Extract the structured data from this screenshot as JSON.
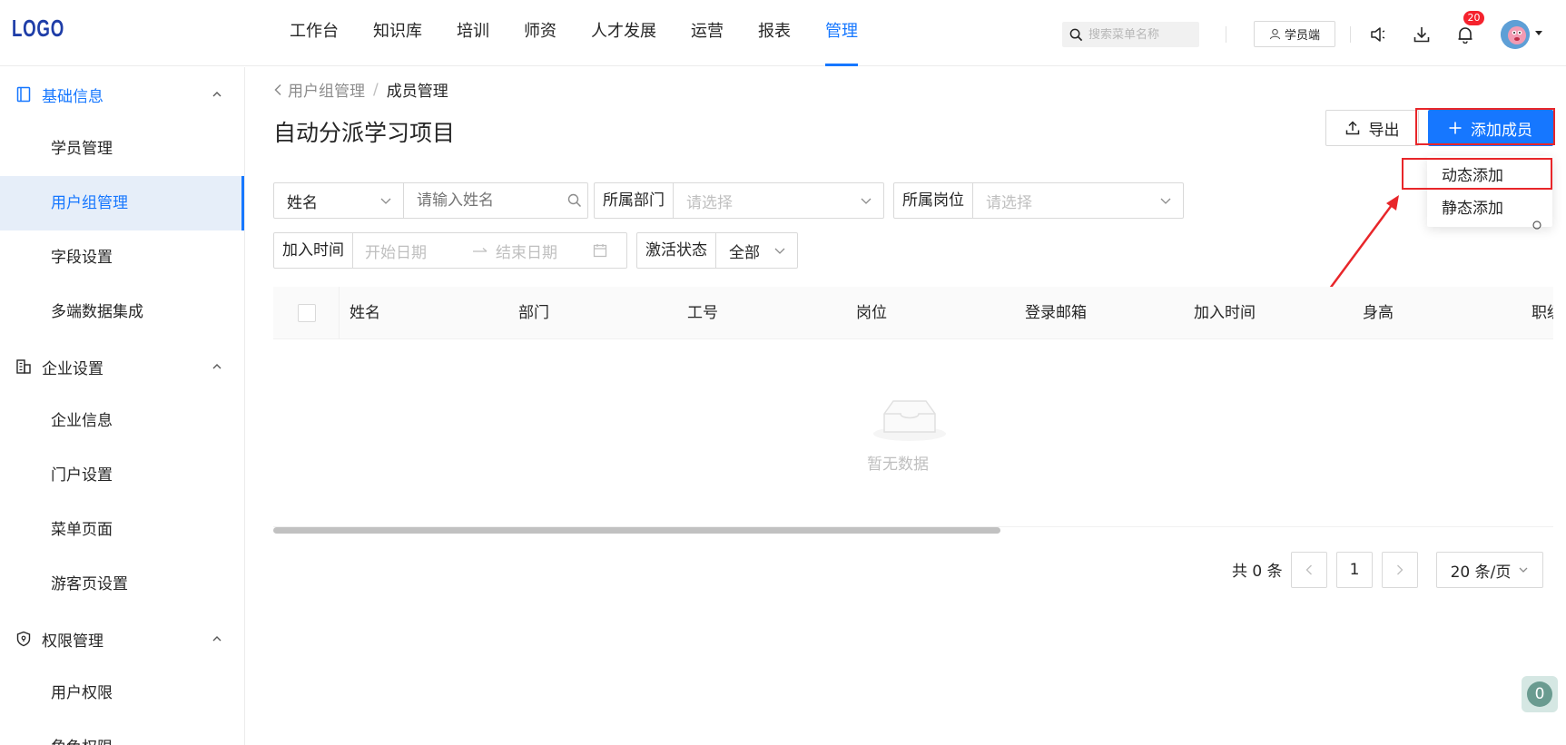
{
  "logo": "LOGO",
  "topnav": [
    "工作台",
    "知识库",
    "培训",
    "师资",
    "人才发展",
    "运营",
    "报表",
    "管理"
  ],
  "topnav_active_index": 7,
  "search": {
    "placeholder": "搜索菜单名称"
  },
  "student_button": "学员端",
  "notification_count": "20",
  "sidebar": {
    "groups": [
      {
        "label": "基础信息",
        "icon": "book-icon",
        "items": [
          "学员管理",
          "用户组管理",
          "字段设置",
          "多端数据集成"
        ]
      },
      {
        "label": "企业设置",
        "icon": "building-icon",
        "items": [
          "企业信息",
          "门户设置",
          "菜单页面",
          "游客页设置"
        ]
      },
      {
        "label": "权限管理",
        "icon": "shield-icon",
        "items": [
          "用户权限",
          "角色权限"
        ]
      }
    ],
    "active_item": "用户组管理"
  },
  "breadcrumb": {
    "parent": "用户组管理",
    "separator": "/",
    "current": "成员管理"
  },
  "page_title": "自动分派学习项目",
  "buttons": {
    "export": "导出",
    "add_member": "添加成员"
  },
  "add_dropdown": [
    "动态添加",
    "静态添加"
  ],
  "filters": {
    "name_field": "姓名",
    "name_placeholder": "请输入姓名",
    "department_label": "所属部门",
    "department_placeholder": "请选择",
    "position_label": "所属岗位",
    "position_placeholder": "请选择",
    "join_time_label": "加入时间",
    "start_date_placeholder": "开始日期",
    "end_date_placeholder": "结束日期",
    "status_label": "激活状态",
    "status_value": "全部"
  },
  "table": {
    "columns": [
      "姓名",
      "部门",
      "工号",
      "岗位",
      "登录邮箱",
      "加入时间",
      "身高",
      "职级"
    ],
    "empty_text": "暂无数据"
  },
  "pagination": {
    "total": "共 0 条",
    "current_page": "1",
    "page_size": "20 条/页"
  },
  "float_badge": "0",
  "colors": {
    "primary": "#1677ff",
    "highlight": "#e8262a"
  }
}
